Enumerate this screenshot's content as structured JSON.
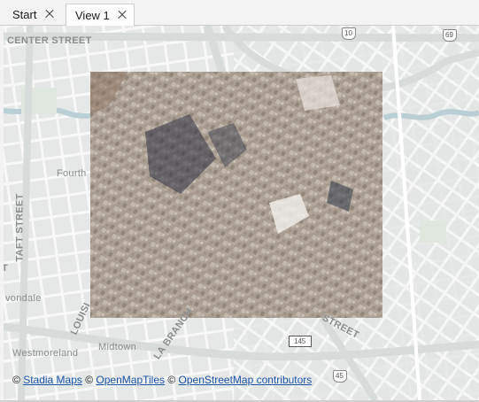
{
  "tabs": [
    {
      "label": "Start",
      "active": false
    },
    {
      "label": "View 1",
      "active": true
    }
  ],
  "map": {
    "labels": {
      "center_street": "CENTER STREET",
      "taft_street": "TAFT STREET",
      "fourth": "Fourth",
      "avondale": "vondale",
      "louisiana": "LOUISI",
      "midtown": "Midtown",
      "la_branch": "LA BRANCH",
      "westmoreland": "Westmoreland",
      "street": "STREET",
      "t_letter": "T"
    },
    "shields": {
      "i10": "10",
      "i69": "69",
      "i45_bottom": "45",
      "label_145": "145"
    },
    "attribution": {
      "copyright_1": "©",
      "stadia": "Stadia Maps",
      "copyright_2": "©",
      "openmaptiles": "OpenMapTiles",
      "copyright_3": "©",
      "osm": "OpenStreetMap contributors"
    }
  },
  "colors": {
    "map_bg": "#eceeed",
    "road": "#ffffff",
    "freeway": "#d7dbd9",
    "water": "#b9cfd4",
    "park": "#dfe7de",
    "link": "#1a55a8"
  },
  "icons": {
    "tab_close": "close-icon"
  }
}
